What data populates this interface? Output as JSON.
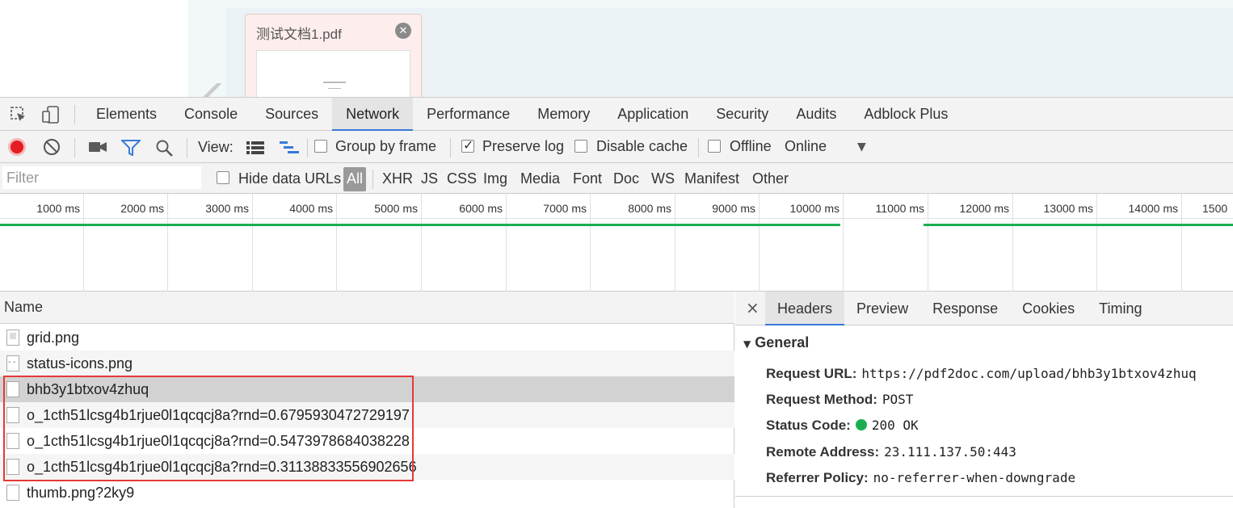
{
  "page": {
    "file_name": "测试文档1.pdf",
    "close_glyph": "✕"
  },
  "devtools": {
    "tabs": [
      "Elements",
      "Console",
      "Sources",
      "Network",
      "Performance",
      "Memory",
      "Application",
      "Security",
      "Audits",
      "Adblock Plus"
    ],
    "active_tab": "Network"
  },
  "toolbar": {
    "view_label": "View:",
    "group_by_frame": "Group by frame",
    "preserve_log": "Preserve log",
    "disable_cache": "Disable cache",
    "offline": "Offline",
    "online": "Online",
    "group_by_frame_checked": false,
    "preserve_log_checked": true,
    "disable_cache_checked": false,
    "offline_checked": false
  },
  "filterbar": {
    "placeholder": "Filter",
    "hide_data_urls": "Hide data URLs",
    "types": [
      "All",
      "XHR",
      "JS",
      "CSS",
      "Img",
      "Media",
      "Font",
      "Doc",
      "WS",
      "Manifest",
      "Other"
    ]
  },
  "timeline": {
    "ticks": [
      "1000 ms",
      "2000 ms",
      "3000 ms",
      "4000 ms",
      "5000 ms",
      "6000 ms",
      "7000 ms",
      "8000 ms",
      "9000 ms",
      "10000 ms",
      "11000 ms",
      "12000 ms",
      "13000 ms",
      "14000 ms",
      "1500"
    ]
  },
  "requests": {
    "header": "Name",
    "rows": [
      {
        "name": "grid.png",
        "icon": "image-file-icon"
      },
      {
        "name": "status-icons.png",
        "icon": "image-file-icon"
      },
      {
        "name": "bhb3y1btxov4zhuq",
        "icon": "document-file-icon",
        "selected": true
      },
      {
        "name": "o_1cth51lcsg4b1rjue0l1qcqcj8a?rnd=0.6795930472729197",
        "icon": "document-file-icon"
      },
      {
        "name": "o_1cth51lcsg4b1rjue0l1qcqcj8a?rnd=0.5473978684038228",
        "icon": "document-file-icon"
      },
      {
        "name": "o_1cth51lcsg4b1rjue0l1qcqcj8a?rnd=0.31138833556902656",
        "icon": "document-file-icon"
      },
      {
        "name": "thumb.png?2ky9",
        "icon": "document-file-icon"
      }
    ]
  },
  "details": {
    "close": "×",
    "tabs": [
      "Headers",
      "Preview",
      "Response",
      "Cookies",
      "Timing"
    ],
    "active_tab": "Headers",
    "section": "General",
    "request_url_label": "Request URL:",
    "request_url": "https://pdf2doc.com/upload/bhb3y1btxov4zhuq",
    "request_method_label": "Request Method:",
    "request_method": "POST",
    "status_code_label": "Status Code:",
    "status_code": "200 OK",
    "status_color": "#1aae52",
    "remote_address_label": "Remote Address:",
    "remote_address": "23.111.137.50:443",
    "referrer_policy_label": "Referrer Policy:",
    "referrer_policy": "no-referrer-when-downgrade"
  },
  "colors": {
    "accent": "#3879d9",
    "record": "#e51c23",
    "highlight_box": "#e53935"
  }
}
